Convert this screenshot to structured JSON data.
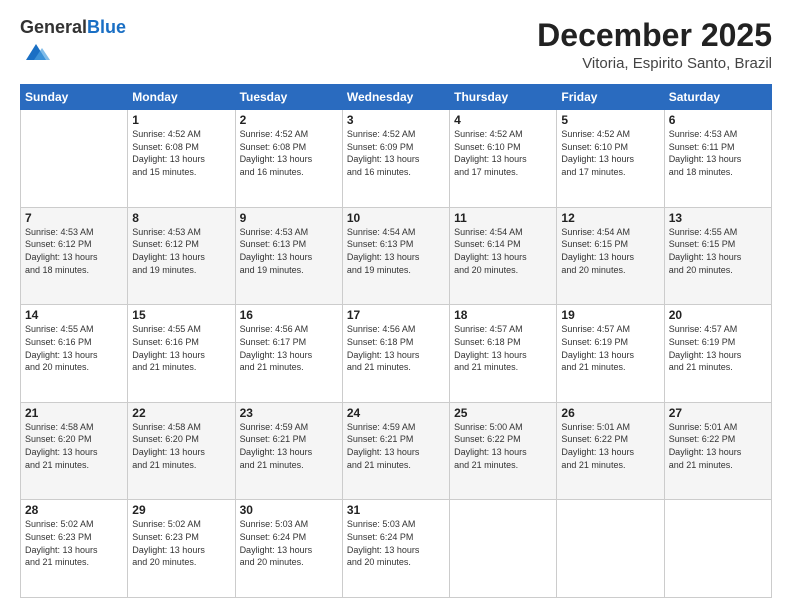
{
  "logo": {
    "general": "General",
    "blue": "Blue"
  },
  "header": {
    "month": "December 2025",
    "location": "Vitoria, Espirito Santo, Brazil"
  },
  "weekdays": [
    "Sunday",
    "Monday",
    "Tuesday",
    "Wednesday",
    "Thursday",
    "Friday",
    "Saturday"
  ],
  "weeks": [
    [
      {
        "day": "",
        "info": ""
      },
      {
        "day": "1",
        "info": "Sunrise: 4:52 AM\nSunset: 6:08 PM\nDaylight: 13 hours\nand 15 minutes."
      },
      {
        "day": "2",
        "info": "Sunrise: 4:52 AM\nSunset: 6:08 PM\nDaylight: 13 hours\nand 16 minutes."
      },
      {
        "day": "3",
        "info": "Sunrise: 4:52 AM\nSunset: 6:09 PM\nDaylight: 13 hours\nand 16 minutes."
      },
      {
        "day": "4",
        "info": "Sunrise: 4:52 AM\nSunset: 6:10 PM\nDaylight: 13 hours\nand 17 minutes."
      },
      {
        "day": "5",
        "info": "Sunrise: 4:52 AM\nSunset: 6:10 PM\nDaylight: 13 hours\nand 17 minutes."
      },
      {
        "day": "6",
        "info": "Sunrise: 4:53 AM\nSunset: 6:11 PM\nDaylight: 13 hours\nand 18 minutes."
      }
    ],
    [
      {
        "day": "7",
        "info": "Sunrise: 4:53 AM\nSunset: 6:12 PM\nDaylight: 13 hours\nand 18 minutes."
      },
      {
        "day": "8",
        "info": "Sunrise: 4:53 AM\nSunset: 6:12 PM\nDaylight: 13 hours\nand 19 minutes."
      },
      {
        "day": "9",
        "info": "Sunrise: 4:53 AM\nSunset: 6:13 PM\nDaylight: 13 hours\nand 19 minutes."
      },
      {
        "day": "10",
        "info": "Sunrise: 4:54 AM\nSunset: 6:13 PM\nDaylight: 13 hours\nand 19 minutes."
      },
      {
        "day": "11",
        "info": "Sunrise: 4:54 AM\nSunset: 6:14 PM\nDaylight: 13 hours\nand 20 minutes."
      },
      {
        "day": "12",
        "info": "Sunrise: 4:54 AM\nSunset: 6:15 PM\nDaylight: 13 hours\nand 20 minutes."
      },
      {
        "day": "13",
        "info": "Sunrise: 4:55 AM\nSunset: 6:15 PM\nDaylight: 13 hours\nand 20 minutes."
      }
    ],
    [
      {
        "day": "14",
        "info": "Sunrise: 4:55 AM\nSunset: 6:16 PM\nDaylight: 13 hours\nand 20 minutes."
      },
      {
        "day": "15",
        "info": "Sunrise: 4:55 AM\nSunset: 6:16 PM\nDaylight: 13 hours\nand 21 minutes."
      },
      {
        "day": "16",
        "info": "Sunrise: 4:56 AM\nSunset: 6:17 PM\nDaylight: 13 hours\nand 21 minutes."
      },
      {
        "day": "17",
        "info": "Sunrise: 4:56 AM\nSunset: 6:18 PM\nDaylight: 13 hours\nand 21 minutes."
      },
      {
        "day": "18",
        "info": "Sunrise: 4:57 AM\nSunset: 6:18 PM\nDaylight: 13 hours\nand 21 minutes."
      },
      {
        "day": "19",
        "info": "Sunrise: 4:57 AM\nSunset: 6:19 PM\nDaylight: 13 hours\nand 21 minutes."
      },
      {
        "day": "20",
        "info": "Sunrise: 4:57 AM\nSunset: 6:19 PM\nDaylight: 13 hours\nand 21 minutes."
      }
    ],
    [
      {
        "day": "21",
        "info": "Sunrise: 4:58 AM\nSunset: 6:20 PM\nDaylight: 13 hours\nand 21 minutes."
      },
      {
        "day": "22",
        "info": "Sunrise: 4:58 AM\nSunset: 6:20 PM\nDaylight: 13 hours\nand 21 minutes."
      },
      {
        "day": "23",
        "info": "Sunrise: 4:59 AM\nSunset: 6:21 PM\nDaylight: 13 hours\nand 21 minutes."
      },
      {
        "day": "24",
        "info": "Sunrise: 4:59 AM\nSunset: 6:21 PM\nDaylight: 13 hours\nand 21 minutes."
      },
      {
        "day": "25",
        "info": "Sunrise: 5:00 AM\nSunset: 6:22 PM\nDaylight: 13 hours\nand 21 minutes."
      },
      {
        "day": "26",
        "info": "Sunrise: 5:01 AM\nSunset: 6:22 PM\nDaylight: 13 hours\nand 21 minutes."
      },
      {
        "day": "27",
        "info": "Sunrise: 5:01 AM\nSunset: 6:22 PM\nDaylight: 13 hours\nand 21 minutes."
      }
    ],
    [
      {
        "day": "28",
        "info": "Sunrise: 5:02 AM\nSunset: 6:23 PM\nDaylight: 13 hours\nand 21 minutes."
      },
      {
        "day": "29",
        "info": "Sunrise: 5:02 AM\nSunset: 6:23 PM\nDaylight: 13 hours\nand 20 minutes."
      },
      {
        "day": "30",
        "info": "Sunrise: 5:03 AM\nSunset: 6:24 PM\nDaylight: 13 hours\nand 20 minutes."
      },
      {
        "day": "31",
        "info": "Sunrise: 5:03 AM\nSunset: 6:24 PM\nDaylight: 13 hours\nand 20 minutes."
      },
      {
        "day": "",
        "info": ""
      },
      {
        "day": "",
        "info": ""
      },
      {
        "day": "",
        "info": ""
      }
    ]
  ]
}
